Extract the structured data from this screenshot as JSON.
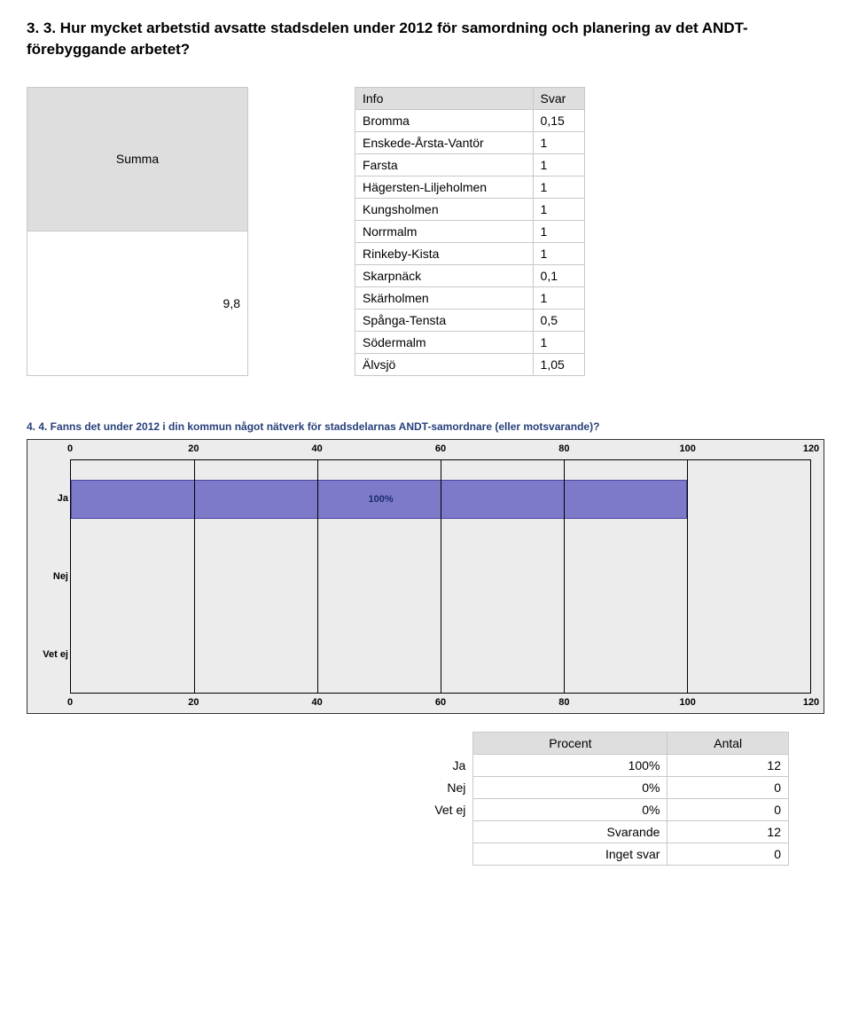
{
  "heading": "3. 3. Hur mycket arbetstid avsatte stadsdelen under 2012 för samordning och planering av det ANDT-förebyggande arbetet?",
  "summa": {
    "label": "Summa",
    "value": "9,8"
  },
  "info_table": {
    "headers": {
      "info": "Info",
      "svar": "Svar"
    },
    "rows": [
      {
        "label": "Bromma",
        "value": "0,15"
      },
      {
        "label": "Enskede-Årsta-Vantör",
        "value": "1"
      },
      {
        "label": "Farsta",
        "value": "1"
      },
      {
        "label": "Hägersten-Liljeholmen",
        "value": "1"
      },
      {
        "label": "Kungsholmen",
        "value": "1"
      },
      {
        "label": "Norrmalm",
        "value": "1"
      },
      {
        "label": "Rinkeby-Kista",
        "value": "1"
      },
      {
        "label": "Skarpnäck",
        "value": "0,1"
      },
      {
        "label": "Skärholmen",
        "value": "1"
      },
      {
        "label": "Spånga-Tensta",
        "value": "0,5"
      },
      {
        "label": "Södermalm",
        "value": "1"
      },
      {
        "label": "Älvsjö",
        "value": "1,05"
      }
    ]
  },
  "chart_data": {
    "type": "bar",
    "orientation": "horizontal",
    "title": "4. 4. Fanns det under 2012 i din kommun något nätverk för stadsdelarnas ANDT-samordnare (eller motsvarande)?",
    "categories": [
      "Ja",
      "Nej",
      "Vet ej"
    ],
    "values": [
      100,
      0,
      0
    ],
    "value_labels": [
      "100%",
      "",
      ""
    ],
    "xlabel": "",
    "ylabel": "",
    "xlim": [
      0,
      120
    ],
    "xticks": [
      0,
      20,
      40,
      60,
      80,
      100,
      120
    ]
  },
  "percent_table": {
    "headers": {
      "procent": "Procent",
      "antal": "Antal"
    },
    "rows": [
      {
        "label": "Ja",
        "procent": "100%",
        "antal": "12"
      },
      {
        "label": "Nej",
        "procent": "0%",
        "antal": "0"
      },
      {
        "label": "Vet ej",
        "procent": "0%",
        "antal": "0"
      }
    ],
    "footer": [
      {
        "label": "Svarande",
        "value": "12"
      },
      {
        "label": "Inget svar",
        "value": "0"
      }
    ]
  }
}
